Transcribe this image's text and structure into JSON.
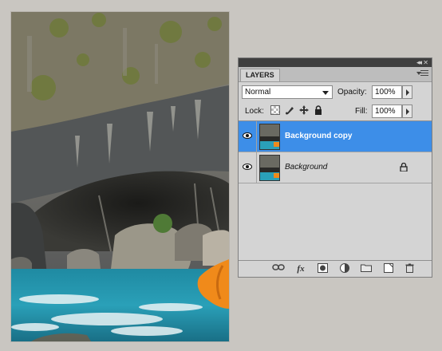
{
  "panel": {
    "tab_label": "LAYERS",
    "blend_mode": "Normal",
    "opacity_label": "Opacity:",
    "opacity_value": "100%",
    "lock_label": "Lock:",
    "fill_label": "Fill:",
    "fill_value": "100%",
    "collapse_glyph": "◂◂",
    "close_glyph": "✕",
    "fx_glyph": "fx"
  },
  "layers": [
    {
      "name": "Background copy",
      "selected": true,
      "visible": true,
      "locked": false
    },
    {
      "name": "Background",
      "selected": false,
      "visible": true,
      "locked": true
    }
  ],
  "colors": {
    "selection": "#3d8ee8",
    "panel_bg": "#d4d4d4",
    "workspace_bg": "#c9c6c1"
  },
  "icons": {
    "lock_options": [
      "lock-transparent-icon",
      "lock-image-icon",
      "lock-position-icon",
      "lock-all-icon"
    ],
    "footer": [
      "link-layers-icon",
      "layer-style-fx-icon",
      "layer-mask-icon",
      "adjustment-layer-icon",
      "new-group-icon",
      "new-layer-icon",
      "delete-layer-icon"
    ]
  }
}
